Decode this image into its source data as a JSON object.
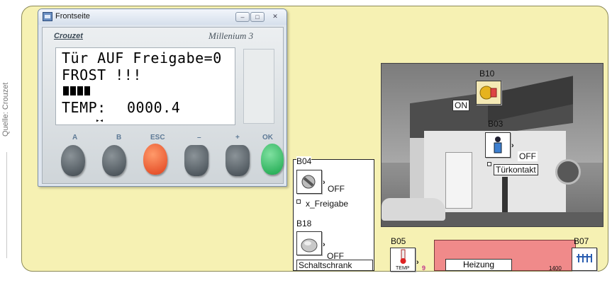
{
  "source_label": "Quelle: Crouzet",
  "window": {
    "title": "Frontseite",
    "buttons": {
      "minimize": "–",
      "maximize": "□",
      "close": "✕"
    },
    "brand": "Crouzet",
    "model": "Millenium 3"
  },
  "lcd": {
    "line1": "Tür AUF Freigabe=0",
    "line2": "FROST !!!",
    "line4_label": "TEMP:",
    "line4_value": "0000.4",
    "arrow": "▸◂"
  },
  "keypad": {
    "keys": [
      "A",
      "B",
      "ESC",
      "–",
      "+",
      "OK"
    ]
  },
  "photo_blocks": {
    "b10": {
      "id": "B10",
      "state": "ON"
    },
    "b03": {
      "id": "B03",
      "state": "OFF",
      "label": "Türkontakt"
    }
  },
  "blocks": {
    "b04": {
      "id": "B04",
      "state": "OFF",
      "label": "x_Freigabe"
    },
    "b18": {
      "id": "B18",
      "state": "OFF",
      "label": "Schaltschrank"
    },
    "b05": {
      "id": "B05",
      "sub": "TEMP",
      "out": "9"
    },
    "b07": {
      "id": "B07"
    },
    "heizung": {
      "label": "Heizung",
      "value": "1400"
    }
  },
  "colors": {
    "panel": "#f6f1b3",
    "heizung": "#f08a8a",
    "esc_key": "#e0401b",
    "ok_key": "#17a54a"
  }
}
